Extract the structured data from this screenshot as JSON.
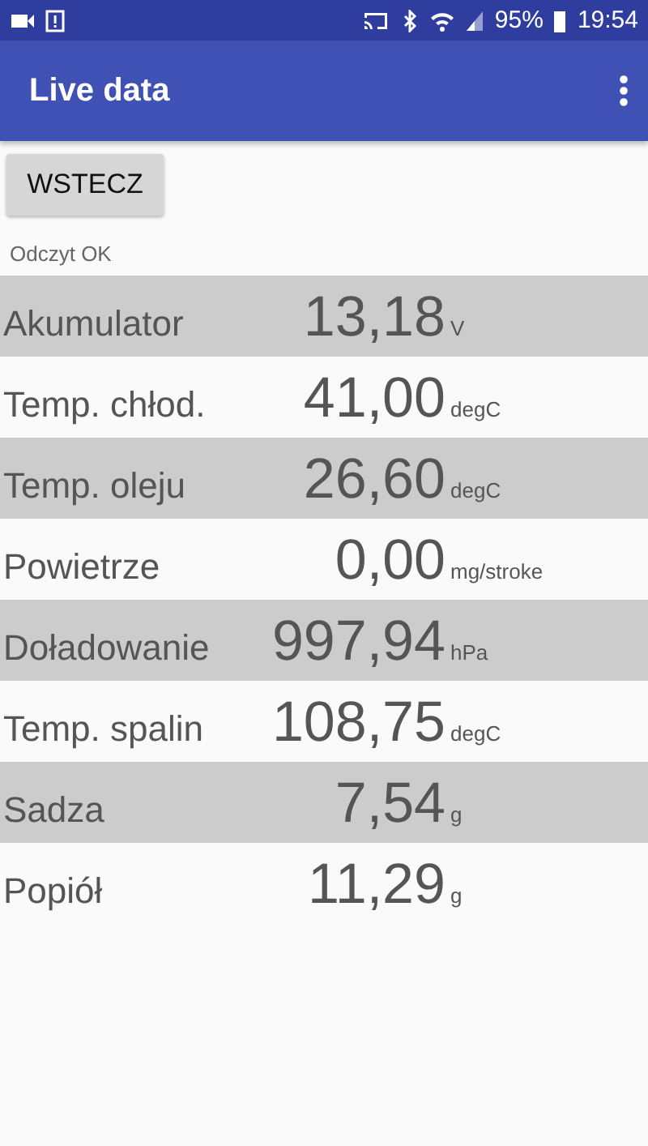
{
  "status_bar": {
    "battery": "95%",
    "time": "19:54"
  },
  "app_bar": {
    "title": "Live data"
  },
  "back_button": {
    "label": "WSTECZ"
  },
  "status_message": "Odczyt OK",
  "readings": [
    {
      "label": "Akumulator",
      "value": "13,18",
      "unit": "V"
    },
    {
      "label": "Temp. chłod.",
      "value": "41,00",
      "unit": "degC"
    },
    {
      "label": "Temp. oleju",
      "value": "26,60",
      "unit": "degC"
    },
    {
      "label": "Powietrze",
      "value": "0,00",
      "unit": "mg/stroke"
    },
    {
      "label": "Doładowanie",
      "value": "997,94",
      "unit": "hPa"
    },
    {
      "label": "Temp. spalin",
      "value": "108,75",
      "unit": "degC"
    },
    {
      "label": "Sadza",
      "value": "7,54",
      "unit": "g"
    },
    {
      "label": "Popiół",
      "value": "11,29",
      "unit": "g"
    }
  ]
}
